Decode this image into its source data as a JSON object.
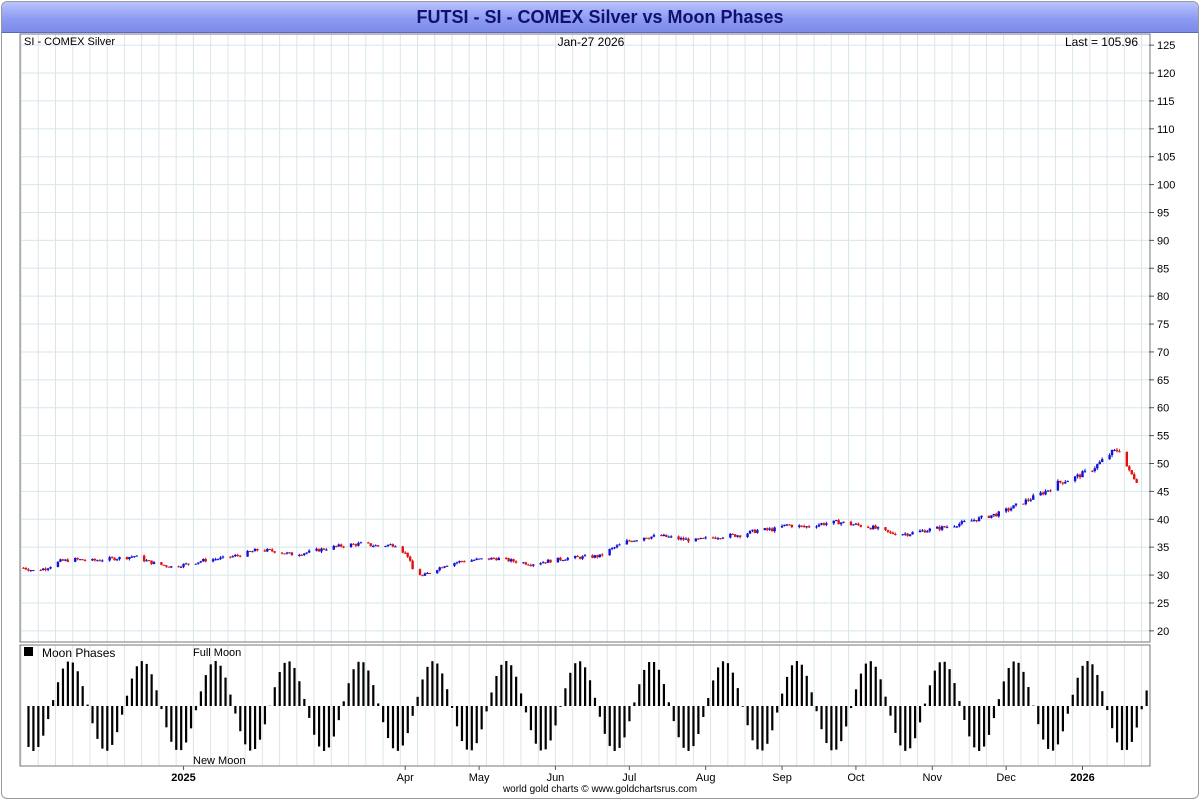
{
  "title": "FUTSI - SI  -  COMEX Silver vs Moon Phases",
  "footer": "world gold charts © www.goldchartsrus.com",
  "colors": {
    "up": "#1010d8",
    "down": "#e01010",
    "grid": "#d8e6ea",
    "title_bg": "#9aa6f5"
  },
  "chart_data": [
    {
      "type": "candlestick",
      "title": "SI  -  COMEX Silver",
      "date_label": "Jan-27  2026",
      "last_label": "Last = 105.96",
      "y_ticks": [
        20,
        25,
        30,
        35,
        40,
        45,
        50,
        55,
        60,
        65,
        70,
        75,
        80,
        85,
        90,
        95,
        100,
        105,
        110,
        115,
        120,
        125
      ],
      "ylim": [
        18,
        127
      ],
      "x_labels": [
        {
          "label": "2025",
          "bold": true,
          "date": "2025-01-01"
        },
        {
          "label": "Apr",
          "bold": false,
          "date": "2025-04-01"
        },
        {
          "label": "May",
          "bold": false,
          "date": "2025-05-01"
        },
        {
          "label": "Jun",
          "bold": false,
          "date": "2025-06-01"
        },
        {
          "label": "Jul",
          "bold": false,
          "date": "2025-07-01"
        },
        {
          "label": "Aug",
          "bold": false,
          "date": "2025-08-01"
        },
        {
          "label": "Sep",
          "bold": false,
          "date": "2025-09-01"
        },
        {
          "label": "Oct",
          "bold": false,
          "date": "2025-10-01"
        },
        {
          "label": "Nov",
          "bold": false,
          "date": "2025-11-01"
        },
        {
          "label": "Dec",
          "bold": false,
          "date": "2025-12-01"
        },
        {
          "label": "2026",
          "bold": true,
          "date": "2026-01-01"
        }
      ],
      "close_series": [
        [
          "2024-10-28",
          31.3
        ],
        [
          "2024-11-01",
          30.8
        ],
        [
          "2024-11-06",
          31.2
        ],
        [
          "2024-11-12",
          32.5
        ],
        [
          "2024-11-18",
          32.8
        ],
        [
          "2024-11-25",
          32.6
        ],
        [
          "2024-12-02",
          32.9
        ],
        [
          "2024-12-09",
          33.2
        ],
        [
          "2024-12-12",
          33.4
        ],
        [
          "2024-12-16",
          32.7
        ],
        [
          "2024-12-20",
          32.1
        ],
        [
          "2024-12-27",
          31.5
        ],
        [
          "2025-01-03",
          32.0
        ],
        [
          "2025-01-10",
          32.7
        ],
        [
          "2025-01-17",
          33.0
        ],
        [
          "2025-01-24",
          33.6
        ],
        [
          "2025-01-31",
          34.5
        ],
        [
          "2025-02-07",
          34.3
        ],
        [
          "2025-02-14",
          33.7
        ],
        [
          "2025-02-21",
          34.1
        ],
        [
          "2025-02-28",
          34.8
        ],
        [
          "2025-03-07",
          35.3
        ],
        [
          "2025-03-14",
          35.6
        ],
        [
          "2025-03-21",
          35.2
        ],
        [
          "2025-03-28",
          35.5
        ],
        [
          "2025-04-02",
          33.5
        ],
        [
          "2025-04-04",
          31.0
        ],
        [
          "2025-04-08",
          29.8
        ],
        [
          "2025-04-11",
          30.5
        ],
        [
          "2025-04-17",
          31.8
        ],
        [
          "2025-04-24",
          32.5
        ],
        [
          "2025-05-01",
          32.8
        ],
        [
          "2025-05-08",
          33.0
        ],
        [
          "2025-05-15",
          32.5
        ],
        [
          "2025-05-22",
          32.0
        ],
        [
          "2025-05-29",
          32.5
        ],
        [
          "2025-06-05",
          33.0
        ],
        [
          "2025-06-12",
          33.2
        ],
        [
          "2025-06-19",
          33.4
        ],
        [
          "2025-06-23",
          34.5
        ],
        [
          "2025-06-30",
          36.0
        ],
        [
          "2025-07-07",
          36.8
        ],
        [
          "2025-07-14",
          37.0
        ],
        [
          "2025-07-21",
          36.5
        ],
        [
          "2025-07-28",
          36.2
        ],
        [
          "2025-08-01",
          36.5
        ],
        [
          "2025-08-08",
          37.0
        ],
        [
          "2025-08-15",
          37.2
        ],
        [
          "2025-08-22",
          38.0
        ],
        [
          "2025-08-29",
          38.2
        ],
        [
          "2025-09-03",
          39.0
        ],
        [
          "2025-09-10",
          38.6
        ],
        [
          "2025-09-17",
          39.2
        ],
        [
          "2025-09-24",
          39.5
        ],
        [
          "2025-10-01",
          39.0
        ],
        [
          "2025-10-08",
          38.5
        ],
        [
          "2025-10-15",
          37.5
        ],
        [
          "2025-10-22",
          37.4
        ],
        [
          "2025-10-29",
          38.0
        ],
        [
          "2025-11-05",
          38.5
        ],
        [
          "2025-11-12",
          39.2
        ],
        [
          "2025-11-19",
          40.0
        ],
        [
          "2025-11-24",
          40.6
        ],
        [
          "2025-11-28",
          41.0
        ],
        [
          "2025-12-03",
          42.0
        ],
        [
          "2025-12-10",
          43.5
        ],
        [
          "2025-12-17",
          45.0
        ],
        [
          "2025-12-22",
          46.5
        ],
        [
          "2025-12-29",
          47.5
        ],
        [
          "2026-01-05",
          49.0
        ],
        [
          "2026-01-09",
          50.5
        ],
        [
          "2026-01-13",
          52.0
        ],
        [
          "2026-01-16",
          52.5
        ],
        [
          "2026-01-20",
          48.5
        ],
        [
          "2026-01-23",
          47.0
        ]
      ]
    },
    {
      "type": "bar",
      "title": "Moon Phases",
      "full_moon_label": "Full Moon",
      "new_moon_label": "New Moon"
    }
  ]
}
